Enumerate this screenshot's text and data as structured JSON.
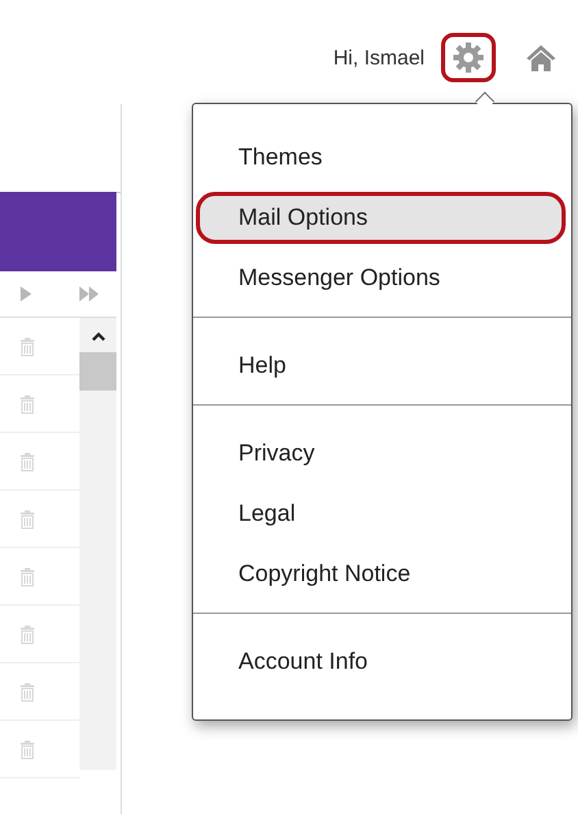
{
  "header": {
    "greeting": "Hi, Ismael",
    "settings_highlighted": true
  },
  "menu": {
    "groups": [
      [
        {
          "label": "Themes",
          "selected": false,
          "highlighted": false
        },
        {
          "label": "Mail Options",
          "selected": true,
          "highlighted": true
        },
        {
          "label": "Messenger Options",
          "selected": false,
          "highlighted": false
        }
      ],
      [
        {
          "label": "Help",
          "selected": false,
          "highlighted": false
        }
      ],
      [
        {
          "label": "Privacy",
          "selected": false,
          "highlighted": false
        },
        {
          "label": "Legal",
          "selected": false,
          "highlighted": false
        },
        {
          "label": "Copyright Notice",
          "selected": false,
          "highlighted": false
        }
      ],
      [
        {
          "label": "Account Info",
          "selected": false,
          "highlighted": false
        }
      ]
    ]
  }
}
